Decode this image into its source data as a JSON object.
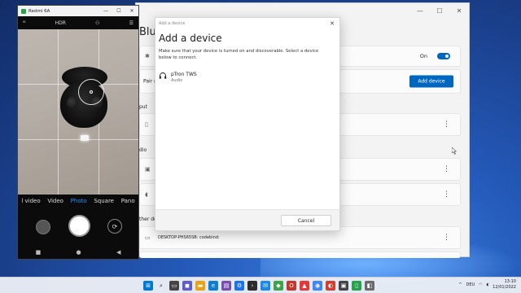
{
  "phone_window": {
    "title": "Redmi 6A",
    "status_hdr": "HDR",
    "status_left": "⁰ᴵ",
    "modes": [
      "l video",
      "Video",
      "Photo",
      "Square",
      "Pano"
    ],
    "active_mode": "Photo"
  },
  "settings": {
    "heading": "Bluet",
    "bluetooth_state": "On",
    "pair_label": "Pair ne",
    "add_device_label": "Add device",
    "section_input": "put",
    "section_audio": "dio",
    "section_other": "ther de",
    "other_device_name": "DESKTOP-PHS65SB: codebind:"
  },
  "dialog": {
    "titlebar": "Add a device",
    "title": "Add a device",
    "description": "Make sure that your device is turned on and discoverable. Select a device below to connect.",
    "devices": [
      {
        "name": "pTron TWS",
        "type": "Audio"
      }
    ],
    "cancel_label": "Cancel"
  },
  "tray": {
    "language": "DEU",
    "time": "13:10",
    "date": "12/01/2022"
  },
  "colors": {
    "accent": "#0067c0",
    "camera_active": "#1e90ff"
  }
}
